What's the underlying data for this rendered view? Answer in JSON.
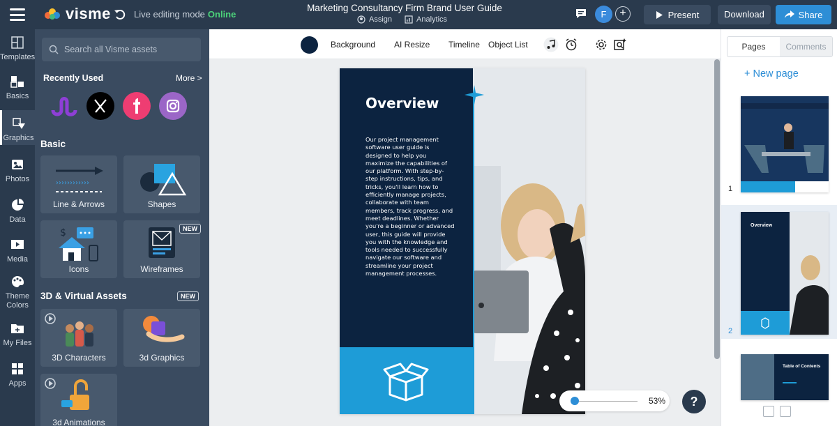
{
  "app": {
    "logo_text": "visme",
    "live_mode_label": "Live editing mode",
    "live_status": "Online",
    "doc_title": "Marketing Consultancy Firm Brand User Guide",
    "assign_label": "Assign",
    "analytics_label": "Analytics",
    "avatar_initial": "F",
    "present_label": "Present",
    "download_label": "Download",
    "share_label": "Share"
  },
  "leftnav": {
    "items": [
      {
        "label": "Templates",
        "icon": "templates-icon"
      },
      {
        "label": "Basics",
        "icon": "basics-icon"
      },
      {
        "label": "Graphics",
        "icon": "graphics-icon",
        "active": true
      },
      {
        "label": "Photos",
        "icon": "photos-icon"
      },
      {
        "label": "Data",
        "icon": "data-icon"
      },
      {
        "label": "Media",
        "icon": "media-icon"
      },
      {
        "label": "Theme\nColors",
        "icon": "theme-colors-icon"
      },
      {
        "label": "My Files",
        "icon": "my-files-icon"
      },
      {
        "label": "Apps",
        "icon": "apps-icon"
      }
    ]
  },
  "panel": {
    "search_placeholder": "Search all Visme assets",
    "recent_title": "Recently Used",
    "more_label": "More >",
    "basic_title": "Basic",
    "tiles": {
      "line_arrows": "Line & Arrows",
      "shapes": "Shapes",
      "icons": "Icons",
      "wireframes": "Wireframes",
      "characters": "3D Characters",
      "graphics3d": "3d Graphics",
      "animations": "3d Animations"
    },
    "new_badge": "NEW",
    "virtual_title": "3D & Virtual Assets"
  },
  "toolbar": {
    "background_label": "Background",
    "ai_resize_label": "AI Resize",
    "timeline_label": "Timeline",
    "object_list_label": "Object List",
    "bg_color": "#0c2340"
  },
  "page": {
    "title": "Overview",
    "body": "Our project management software user guide is designed to help you maximize the capabilities of our platform. With step-by-step instructions, tips, and tricks, you'll learn how to efficiently manage projects, collaborate with team members, track progress, and meet deadlines. Whether you're a beginner or advanced user, this guide will provide you with the knowledge and tools needed to successfully navigate our software and streamline your project management processes.",
    "navy": "#0c2340",
    "cyan": "#1e9cd7"
  },
  "zoom": {
    "percent": "53%",
    "level": 0.53
  },
  "help_label": "?",
  "pages_panel": {
    "tab_pages": "Pages",
    "tab_comments": "Comments",
    "new_page_label": "+ New page",
    "thumbs": [
      {
        "num": "1"
      },
      {
        "num": "2",
        "title": "Overview"
      },
      {
        "title": "Table of Contents"
      }
    ]
  }
}
